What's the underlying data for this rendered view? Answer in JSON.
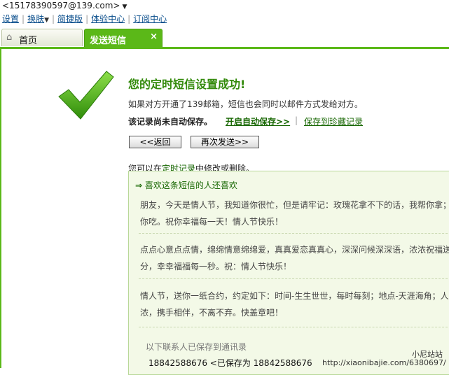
{
  "account": {
    "email": "<15178390597@139.com>",
    "arrow": "▼"
  },
  "menu": {
    "settings": "设置",
    "skin": "换肤",
    "skin_caret": "▼",
    "simple": "简捷版",
    "experience": "体验中心",
    "subscribe": "订阅中心"
  },
  "tabs": {
    "home": "首页",
    "home_icon": "⌂",
    "sms": "发送短信",
    "close": "×"
  },
  "result": {
    "title": "您的定时短信设置成功!",
    "desc": "如果对方开通了139邮箱，短信也会同时以邮件方式发给对方。",
    "warn": "该记录尚未自动保存。",
    "autosave": "开启自动保存>>",
    "separator": "|",
    "keep": "保存到珍藏记录",
    "back_btn": "<<返回",
    "resend_btn": "再次发送>>",
    "hint_prefix": "您可以在",
    "hint_link": "定时记录",
    "hint_suffix": "中修改或删除。"
  },
  "panel": {
    "arrow": "⇒",
    "heading": "喜欢这条短信的人还喜欢",
    "messages": [
      {
        "line1": "朋友，今天是情人节，我知道你很忙，但是请牢记：玫瑰花拿不下的话，我帮你拿；",
        "line2": "你吃。祝你幸福每一天！情人节快乐！"
      },
      {
        "line1": "点点心意点点情，绵绵情意绵绵爱，真真爱恋真真心，深深问候深深语，浓浓祝福送",
        "line2": "分，幸幸福福每一秒。祝：情人节快乐！"
      },
      {
        "line1": "情人节，送你一纸合约，约定如下：时间-生生世世，每时每刻；地点-天涯海角；人",
        "line2": "浓，携手相伴，不离不弃。快盖章吧！"
      }
    ],
    "contacts_title": "以下联系人已保存到通讯录",
    "contact_row": "18842588676 <已保存为 18842588676"
  },
  "watermark": {
    "line1": "小尼站站",
    "line2": "http://xiaonibajie.com/6380697/"
  },
  "colors": {
    "accent": "#5bb818",
    "title": "#338a0b",
    "link": "#166600"
  }
}
